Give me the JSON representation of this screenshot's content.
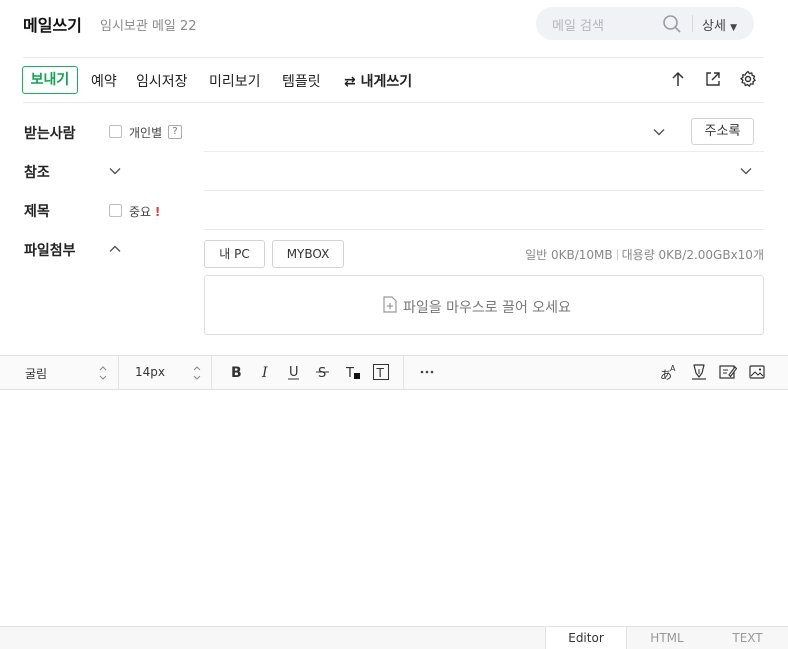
{
  "header": {
    "title": "메일쓰기",
    "subtitle": "임시보관 메일 22",
    "search_placeholder": "메일 검색",
    "search_detail": "상세"
  },
  "toolbar": {
    "send": "보내기",
    "reserve": "예약",
    "temp_save": "임시저장",
    "preview": "미리보기",
    "template": "템플릿",
    "to_self": "내게쓰기"
  },
  "form": {
    "to_label": "받는사람",
    "individual": "개인별",
    "help": "?",
    "address_book": "주소록",
    "cc_label": "참조",
    "subject_label": "제목",
    "important": "중요",
    "important_mark": "!",
    "attach_label": "파일첨부",
    "my_pc": "내 PC",
    "mybox": "MYBOX",
    "quota_normal": "일반 0KB/10MB",
    "quota_large": "대용량 0KB/2.00GBx10개",
    "dropzone_text": "파일을 마우스로 끌어 오세요"
  },
  "editor": {
    "font": "굴림",
    "font_size": "14px",
    "tabs": [
      "Editor",
      "HTML",
      "TEXT"
    ]
  },
  "colors": {
    "accent": "#15b35a",
    "important": "#e53935"
  }
}
